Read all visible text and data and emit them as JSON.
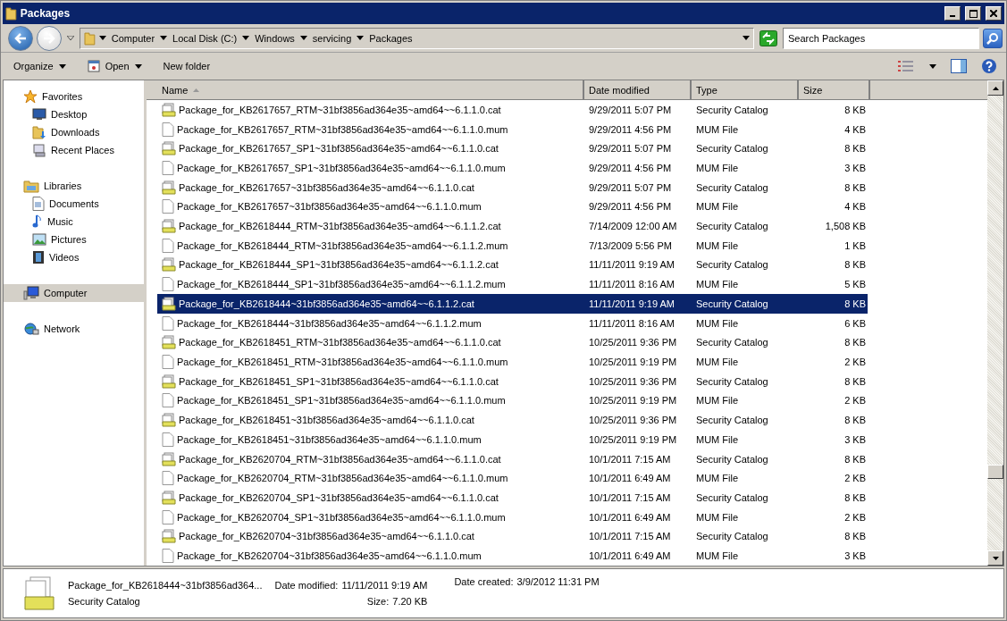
{
  "window": {
    "title": "Packages"
  },
  "address_bar": {
    "crumbs": [
      "Computer",
      "Local Disk (C:)",
      "Windows",
      "servicing",
      "Packages"
    ],
    "search": {
      "placeholder": "Search Packages"
    }
  },
  "toolbar": {
    "buttons": [
      {
        "label": "Organize",
        "dropdown": true
      },
      {
        "label": "Open",
        "dropdown": true,
        "kind": "open"
      },
      {
        "label": "New folder",
        "dropdown": false
      }
    ]
  },
  "sidebar": {
    "sections": [
      {
        "label": "Favorites",
        "kind": "star",
        "selected": false,
        "children": [
          {
            "label": "Desktop",
            "kind": "desktop",
            "selected": false
          },
          {
            "label": "Downloads",
            "kind": "downloads",
            "selected": false
          },
          {
            "label": "Recent Places",
            "kind": "recent",
            "selected": false
          }
        ]
      },
      {
        "label": "Libraries",
        "kind": "library",
        "selected": false,
        "children": [
          {
            "label": "Documents",
            "kind": "documents",
            "selected": false
          },
          {
            "label": "Music",
            "kind": "music",
            "selected": false
          },
          {
            "label": "Pictures",
            "kind": "pictures",
            "selected": false
          },
          {
            "label": "Videos",
            "kind": "videos",
            "selected": false
          }
        ]
      },
      {
        "label": "Computer",
        "kind": "computer",
        "selected": true
      },
      {
        "label": "Network",
        "kind": "network",
        "selected": false
      }
    ]
  },
  "table": {
    "columns": [
      "Name",
      "Date modified",
      "Type",
      "Size"
    ],
    "rows": [
      {
        "kind": "catalog",
        "selected": false,
        "name": "Package_for_KB2617657_RTM~31bf3856ad364e35~amd64~~6.1.1.0.cat",
        "date": "9/29/2011 5:07 PM",
        "type": "Security Catalog",
        "size": "8 KB"
      },
      {
        "kind": "document",
        "selected": false,
        "name": "Package_for_KB2617657_RTM~31bf3856ad364e35~amd64~~6.1.1.0.mum",
        "date": "9/29/2011 4:56 PM",
        "type": "MUM File",
        "size": "4 KB"
      },
      {
        "kind": "catalog",
        "selected": false,
        "name": "Package_for_KB2617657_SP1~31bf3856ad364e35~amd64~~6.1.1.0.cat",
        "date": "9/29/2011 5:07 PM",
        "type": "Security Catalog",
        "size": "8 KB"
      },
      {
        "kind": "document",
        "selected": false,
        "name": "Package_for_KB2617657_SP1~31bf3856ad364e35~amd64~~6.1.1.0.mum",
        "date": "9/29/2011 4:56 PM",
        "type": "MUM File",
        "size": "3 KB"
      },
      {
        "kind": "catalog",
        "selected": false,
        "name": "Package_for_KB2617657~31bf3856ad364e35~amd64~~6.1.1.0.cat",
        "date": "9/29/2011 5:07 PM",
        "type": "Security Catalog",
        "size": "8 KB"
      },
      {
        "kind": "document",
        "selected": false,
        "name": "Package_for_KB2617657~31bf3856ad364e35~amd64~~6.1.1.0.mum",
        "date": "9/29/2011 4:56 PM",
        "type": "MUM File",
        "size": "4 KB"
      },
      {
        "kind": "catalog",
        "selected": false,
        "name": "Package_for_KB2618444_RTM~31bf3856ad364e35~amd64~~6.1.1.2.cat",
        "date": "7/14/2009 12:00 AM",
        "type": "Security Catalog",
        "size": "1,508 KB"
      },
      {
        "kind": "document",
        "selected": false,
        "name": "Package_for_KB2618444_RTM~31bf3856ad364e35~amd64~~6.1.1.2.mum",
        "date": "7/13/2009 5:56 PM",
        "type": "MUM File",
        "size": "1 KB"
      },
      {
        "kind": "catalog",
        "selected": false,
        "name": "Package_for_KB2618444_SP1~31bf3856ad364e35~amd64~~6.1.1.2.cat",
        "date": "11/11/2011 9:19 AM",
        "type": "Security Catalog",
        "size": "8 KB"
      },
      {
        "kind": "document",
        "selected": false,
        "name": "Package_for_KB2618444_SP1~31bf3856ad364e35~amd64~~6.1.1.2.mum",
        "date": "11/11/2011 8:16 AM",
        "type": "MUM File",
        "size": "5 KB"
      },
      {
        "kind": "catalog",
        "selected": true,
        "name": "Package_for_KB2618444~31bf3856ad364e35~amd64~~6.1.1.2.cat",
        "date": "11/11/2011 9:19 AM",
        "type": "Security Catalog",
        "size": "8 KB"
      },
      {
        "kind": "document",
        "selected": false,
        "name": "Package_for_KB2618444~31bf3856ad364e35~amd64~~6.1.1.2.mum",
        "date": "11/11/2011 8:16 AM",
        "type": "MUM File",
        "size": "6 KB"
      },
      {
        "kind": "catalog",
        "selected": false,
        "name": "Package_for_KB2618451_RTM~31bf3856ad364e35~amd64~~6.1.1.0.cat",
        "date": "10/25/2011 9:36 PM",
        "type": "Security Catalog",
        "size": "8 KB"
      },
      {
        "kind": "document",
        "selected": false,
        "name": "Package_for_KB2618451_RTM~31bf3856ad364e35~amd64~~6.1.1.0.mum",
        "date": "10/25/2011 9:19 PM",
        "type": "MUM File",
        "size": "2 KB"
      },
      {
        "kind": "catalog",
        "selected": false,
        "name": "Package_for_KB2618451_SP1~31bf3856ad364e35~amd64~~6.1.1.0.cat",
        "date": "10/25/2011 9:36 PM",
        "type": "Security Catalog",
        "size": "8 KB"
      },
      {
        "kind": "document",
        "selected": false,
        "name": "Package_for_KB2618451_SP1~31bf3856ad364e35~amd64~~6.1.1.0.mum",
        "date": "10/25/2011 9:19 PM",
        "type": "MUM File",
        "size": "2 KB"
      },
      {
        "kind": "catalog",
        "selected": false,
        "name": "Package_for_KB2618451~31bf3856ad364e35~amd64~~6.1.1.0.cat",
        "date": "10/25/2011 9:36 PM",
        "type": "Security Catalog",
        "size": "8 KB"
      },
      {
        "kind": "document",
        "selected": false,
        "name": "Package_for_KB2618451~31bf3856ad364e35~amd64~~6.1.1.0.mum",
        "date": "10/25/2011 9:19 PM",
        "type": "MUM File",
        "size": "3 KB"
      },
      {
        "kind": "catalog",
        "selected": false,
        "name": "Package_for_KB2620704_RTM~31bf3856ad364e35~amd64~~6.1.1.0.cat",
        "date": "10/1/2011 7:15 AM",
        "type": "Security Catalog",
        "size": "8 KB"
      },
      {
        "kind": "document",
        "selected": false,
        "name": "Package_for_KB2620704_RTM~31bf3856ad364e35~amd64~~6.1.1.0.mum",
        "date": "10/1/2011 6:49 AM",
        "type": "MUM File",
        "size": "2 KB"
      },
      {
        "kind": "catalog",
        "selected": false,
        "name": "Package_for_KB2620704_SP1~31bf3856ad364e35~amd64~~6.1.1.0.cat",
        "date": "10/1/2011 7:15 AM",
        "type": "Security Catalog",
        "size": "8 KB"
      },
      {
        "kind": "document",
        "selected": false,
        "name": "Package_for_KB2620704_SP1~31bf3856ad364e35~amd64~~6.1.1.0.mum",
        "date": "10/1/2011 6:49 AM",
        "type": "MUM File",
        "size": "2 KB"
      },
      {
        "kind": "catalog",
        "selected": false,
        "name": "Package_for_KB2620704~31bf3856ad364e35~amd64~~6.1.1.0.cat",
        "date": "10/1/2011 7:15 AM",
        "type": "Security Catalog",
        "size": "8 KB"
      },
      {
        "kind": "document",
        "selected": false,
        "name": "Package_for_KB2620704~31bf3856ad364e35~amd64~~6.1.1.0.mum",
        "date": "10/1/2011 6:49 AM",
        "type": "MUM File",
        "size": "3 KB"
      }
    ]
  },
  "details_pane": {
    "name": "Package_for_KB2618444~31bf3856ad364...",
    "type": "Security Catalog",
    "fields": [
      {
        "label": "Date modified:",
        "value": "11/11/2011 9:19 AM"
      },
      {
        "label": "Size:",
        "value": "7.20 KB"
      },
      {
        "label": "Date created:",
        "value": "3/9/2012 11:31 PM"
      }
    ]
  }
}
